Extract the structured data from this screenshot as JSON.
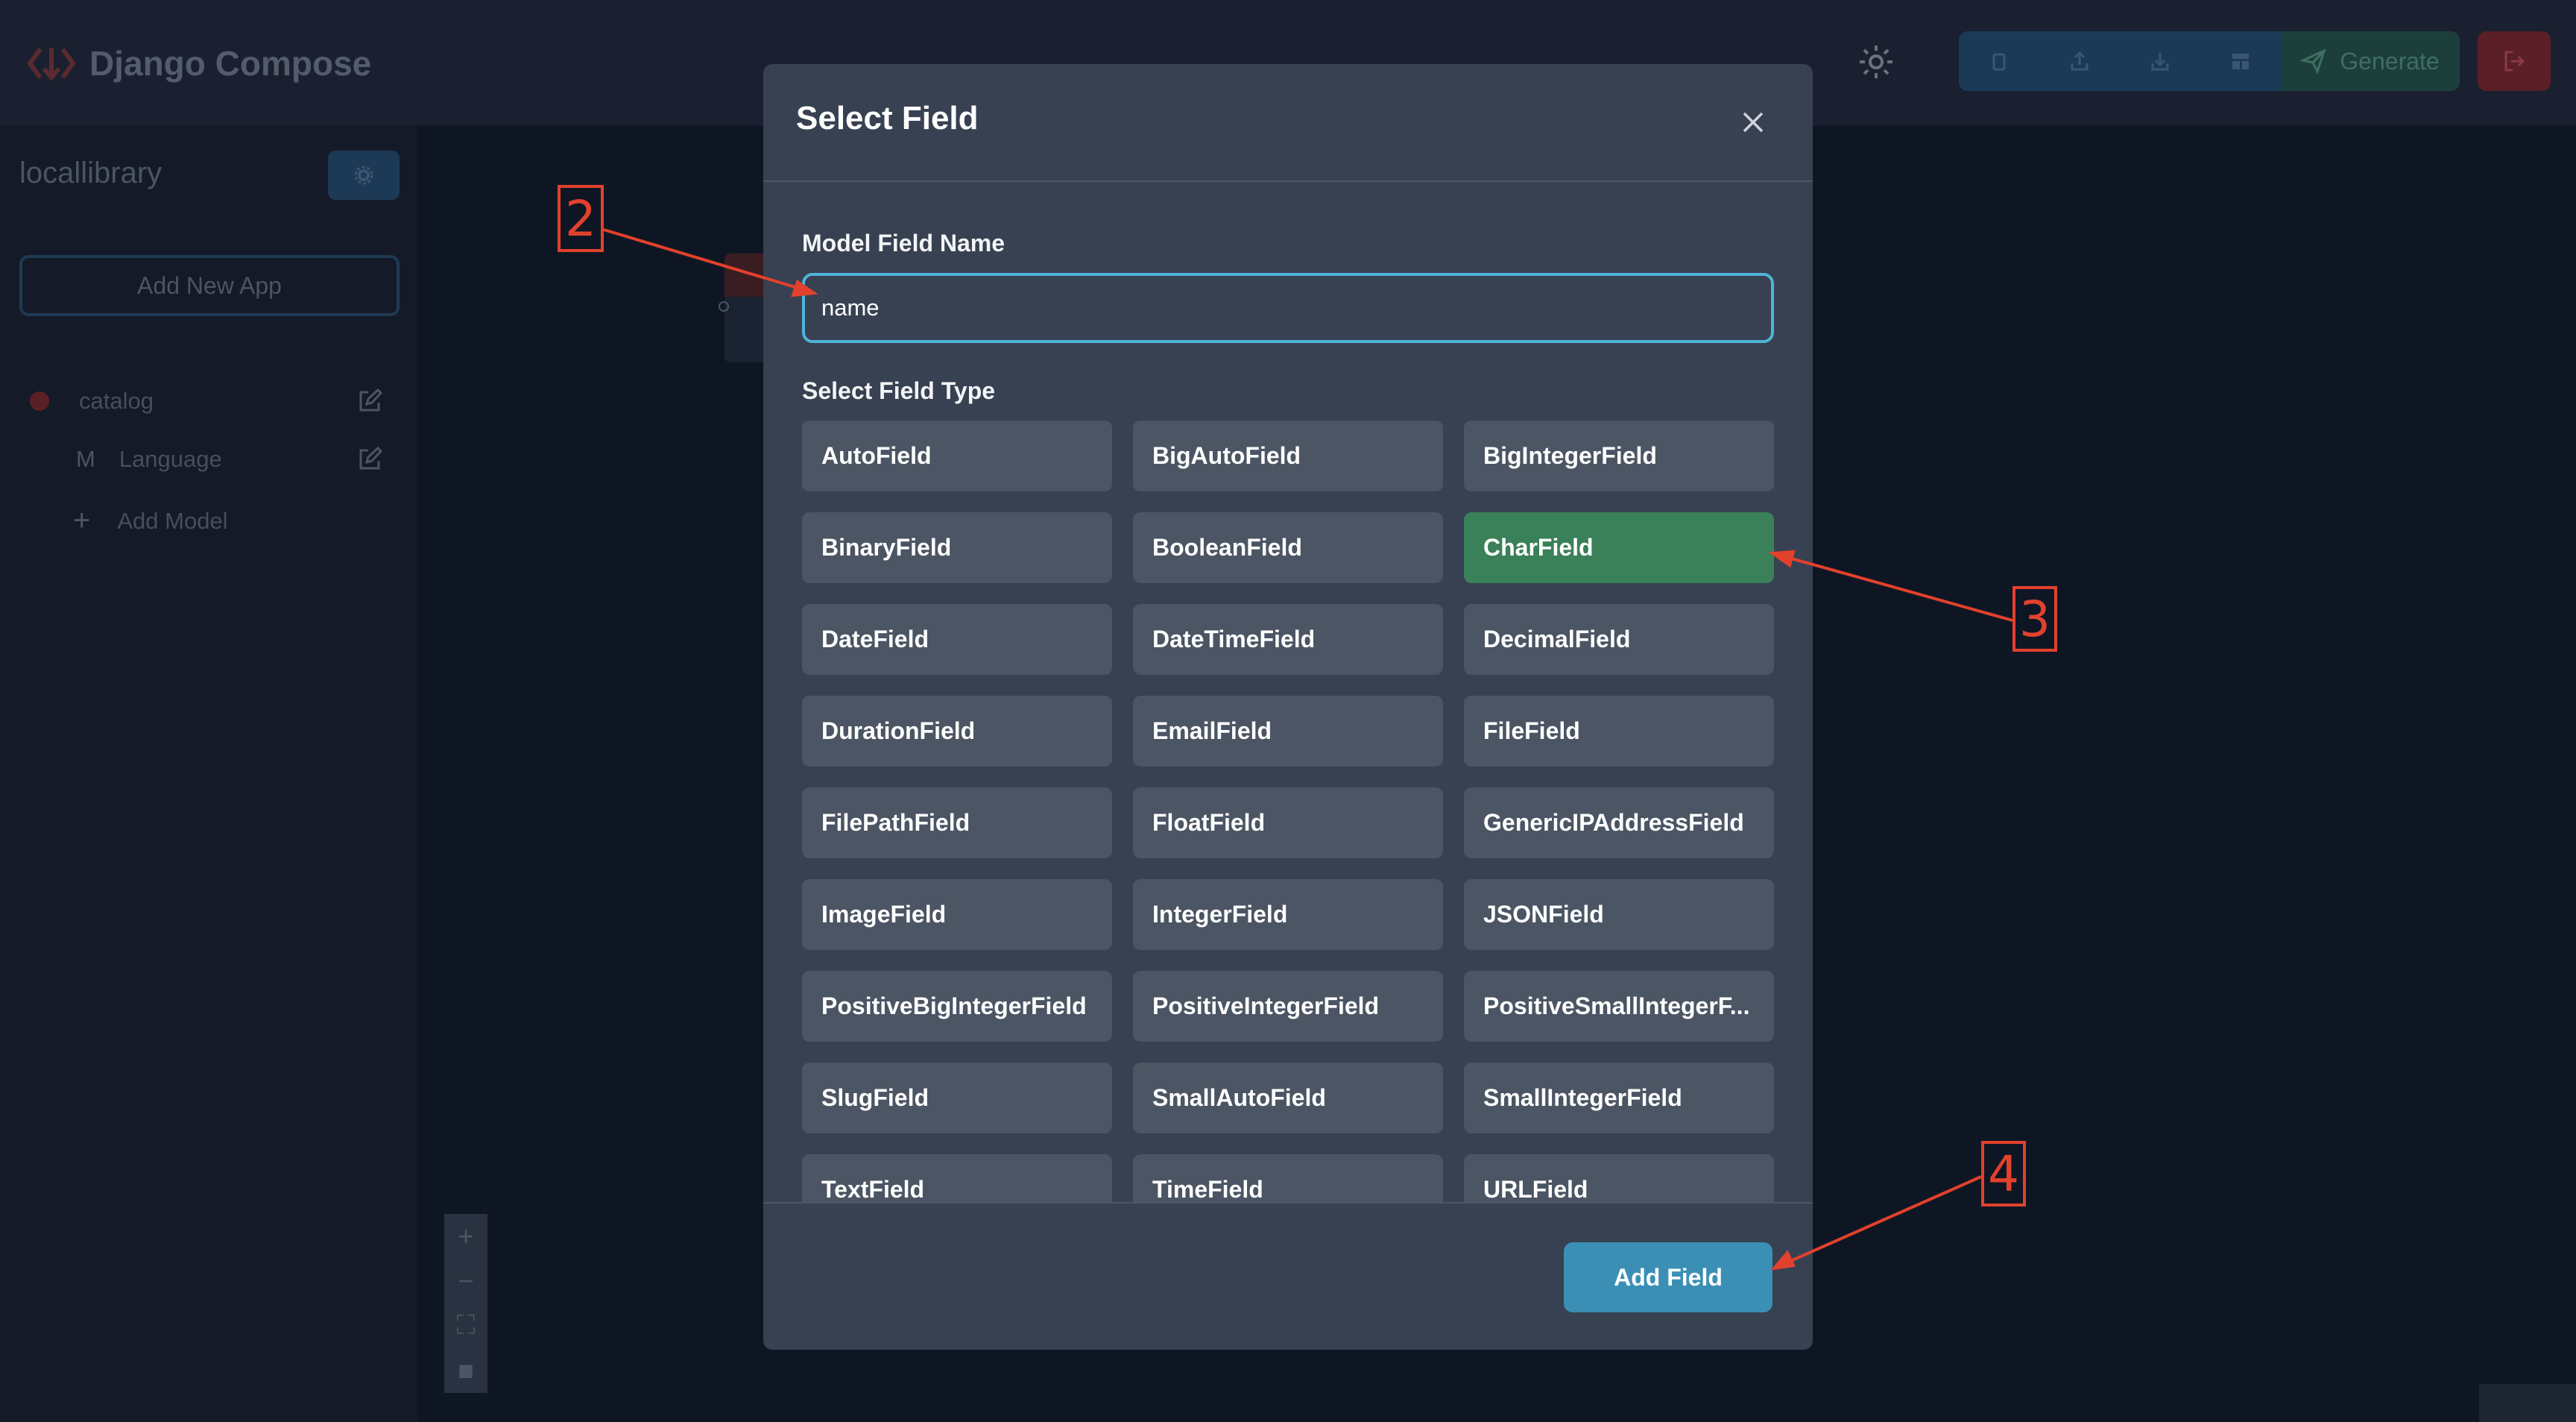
{
  "app": {
    "logo_text": "Django Compose",
    "generate_label": "Generate",
    "icons": {
      "logo": "code-arrows-icon",
      "theme": "sun-icon",
      "toolbar": [
        "trash-icon",
        "export-icon",
        "import-icon",
        "layout-icon"
      ],
      "generate": "send-icon",
      "logout": "logout-icon",
      "settings": "gear-icon"
    }
  },
  "sidebar": {
    "project_name": "locallibrary",
    "add_app_label": "Add New App",
    "app_name": "catalog",
    "model_letter": "M",
    "model_name": "Language",
    "add_model_label": "Add Model"
  },
  "modal": {
    "title": "Select Field",
    "field_name_label": "Model Field Name",
    "field_name_value": "name",
    "field_type_label": "Select Field Type",
    "selected_type": "CharField",
    "field_types": [
      "AutoField",
      "BigAutoField",
      "BigIntegerField",
      "BinaryField",
      "BooleanField",
      "CharField",
      "DateField",
      "DateTimeField",
      "DecimalField",
      "DurationField",
      "EmailField",
      "FileField",
      "FilePathField",
      "FloatField",
      "GenericIPAddressField",
      "ImageField",
      "IntegerField",
      "JSONField",
      "PositiveBigIntegerField",
      "PositiveIntegerField",
      "PositiveSmallIntegerF...",
      "SlugField",
      "SmallAutoField",
      "SmallIntegerField",
      "TextField",
      "TimeField",
      "URLField"
    ],
    "submit_label": "Add Field"
  },
  "annotations": [
    "2",
    "3",
    "4"
  ],
  "colors": {
    "background": "#111827",
    "modal": "#374151",
    "field_button": "#4b5563",
    "selected_field": "#3a8058",
    "primary_button": "#3b8fb5",
    "input_focus": "#4fb3d9",
    "annotation": "#e2412d"
  }
}
